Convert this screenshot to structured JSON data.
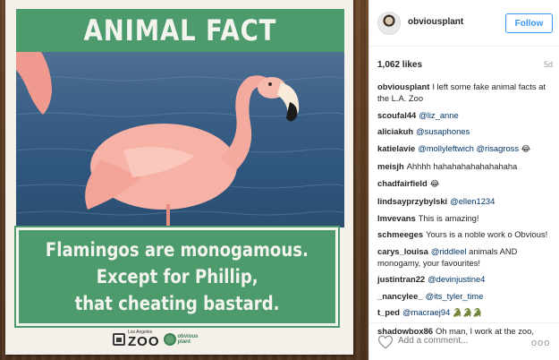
{
  "photo": {
    "sign_header": "ANIMAL FACT",
    "fact_lines": [
      "Flamingos are monogamous.",
      "Except for Phillip,",
      "that cheating bastard."
    ],
    "zoo_logo_small": "Los Angeles",
    "zoo_logo_big": "ZOO",
    "op_logo_lines": [
      "obvious",
      "plant"
    ],
    "colors": {
      "sign_green": "#4d9a6c",
      "flamingo_pink": "#f2a39a",
      "water_blue": "#3a5f86"
    }
  },
  "post": {
    "username": "obviousplant",
    "follow_label": "Follow",
    "likes": "1,062 likes",
    "age": "5d",
    "icons": {
      "heart": "heart-icon",
      "more": "more-options-icon"
    },
    "add_comment_placeholder": "Add a comment...",
    "more_label": "ooo"
  },
  "comments": [
    {
      "user": "obviousplant",
      "text": "I left some fake animal facts at the L.A. Zoo",
      "mention": "",
      "emoji": ""
    },
    {
      "user": "scoufal44",
      "text": "",
      "mention": "@liz_anne",
      "emoji": ""
    },
    {
      "user": "aliciakuh",
      "text": "",
      "mention": "@susaphones",
      "emoji": ""
    },
    {
      "user": "katielavie",
      "text": "",
      "mention": "@mollyleftwich @risagross",
      "emoji": "😂"
    },
    {
      "user": "meisjh",
      "text": "Ahhhh hahahahahahahahaha",
      "mention": "",
      "emoji": ""
    },
    {
      "user": "chadfairfield",
      "text": "",
      "mention": "",
      "emoji": "😂"
    },
    {
      "user": "lindsayprzybylski",
      "text": "",
      "mention": "@ellen1234",
      "emoji": ""
    },
    {
      "user": "lmvevans",
      "text": "This is amazing!",
      "mention": "",
      "emoji": ""
    },
    {
      "user": "schmeeges",
      "text": "Yours is a noble work o Obvious!",
      "mention": "",
      "emoji": ""
    },
    {
      "user": "carys_louisa",
      "text": "animals AND monogamy, your favourites!",
      "mention": "@riddleel",
      "emoji": ""
    },
    {
      "user": "justintran22",
      "text": "",
      "mention": "@devinjustine4",
      "emoji": ""
    },
    {
      "user": "_nancylee_",
      "text": "",
      "mention": "@its_tyler_time",
      "emoji": ""
    },
    {
      "user": "t_ped",
      "text": "",
      "mention": "@macraej94",
      "emoji": "🐊🐊🐊"
    },
    {
      "user": "shadowbox86",
      "text": "Oh man, I work at the zoo,",
      "mention": "",
      "emoji": ""
    }
  ]
}
